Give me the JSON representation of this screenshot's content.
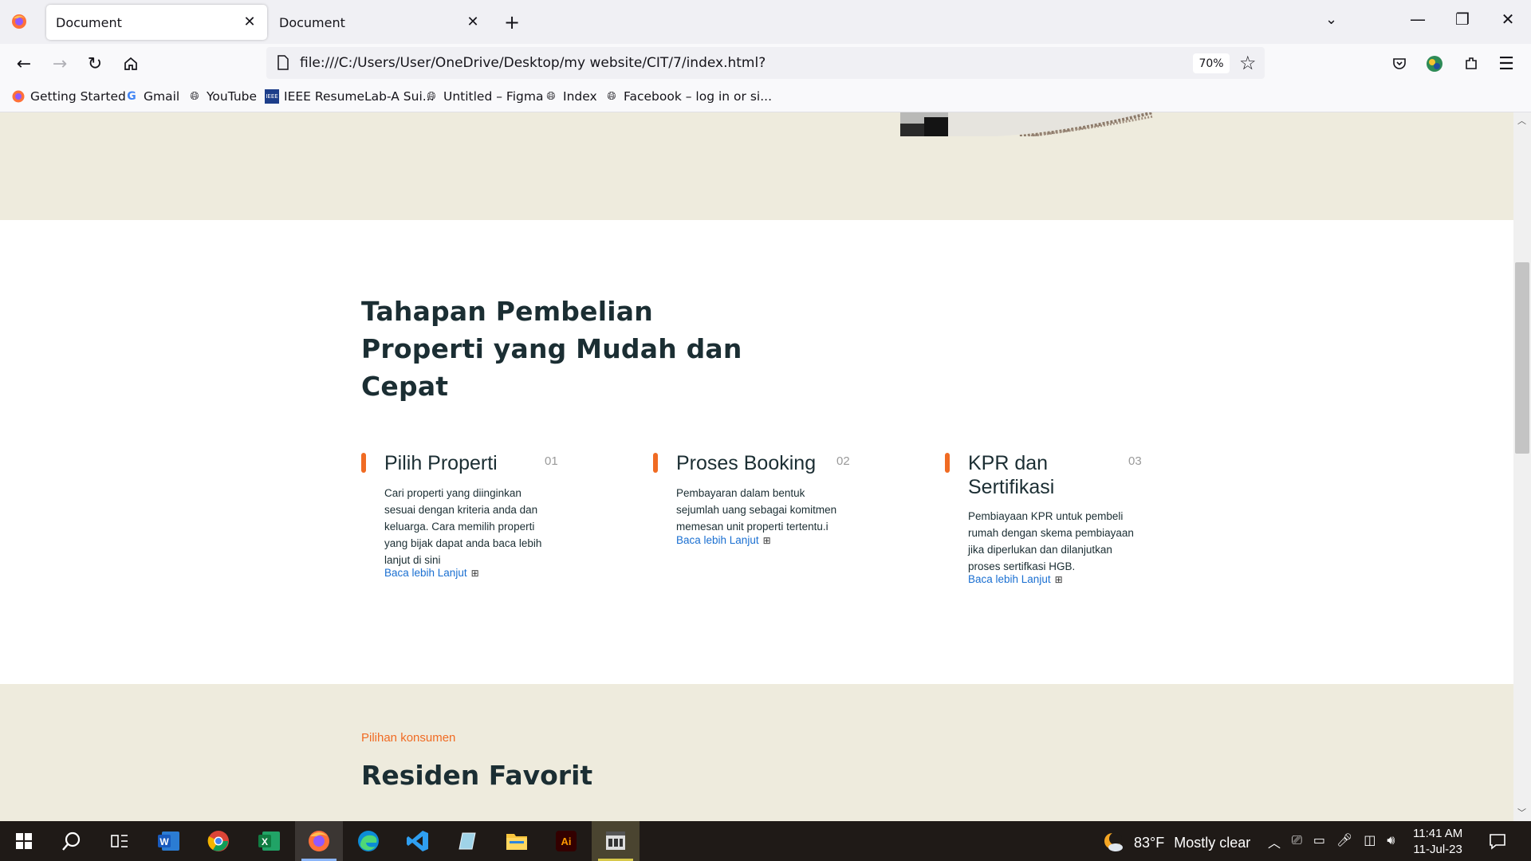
{
  "browser": {
    "tabs": [
      {
        "label": "Document",
        "active": true
      },
      {
        "label": "Document",
        "active": false
      }
    ],
    "url": "file:///C:/Users/User/OneDrive/Desktop/my website/CIT/7/index.html?",
    "zoom": "70%",
    "bookmarks": [
      {
        "label": "Getting Started",
        "icon": "firefox-icon"
      },
      {
        "label": "Gmail",
        "icon": "google-icon"
      },
      {
        "label": "YouTube",
        "icon": "globe-icon"
      },
      {
        "label": "IEEE ResumeLab-A Sui...",
        "icon": "ieee-icon"
      },
      {
        "label": "Untitled – Figma",
        "icon": "globe-icon"
      },
      {
        "label": "Index",
        "icon": "globe-icon"
      },
      {
        "label": "Facebook – log in or si...",
        "icon": "globe-icon"
      }
    ]
  },
  "page": {
    "steps_title": "Tahapan Pembelian Properti yang Mudah dan Cepat",
    "steps": [
      {
        "title": "Pilih Properti",
        "number": "01",
        "description": "Cari properti yang diinginkan sesuai dengan kriteria anda dan keluarga. Cara memilih properti yang bijak dapat anda baca lebih lanjut di sini",
        "link": "Baca lebih Lanjut"
      },
      {
        "title": "Proses Booking",
        "number": "02",
        "description": "Pembayaran dalam bentuk sejumlah uang sebagai komitmen memesan unit properti tertentu.i",
        "link": "Baca lebih Lanjut"
      },
      {
        "title": "KPR dan Sertifikasi",
        "number": "03",
        "description": "Pembiayaan KPR untuk pembeli rumah dengan skema pembiayaan jika diperlukan dan dilanjutkan proses sertifkasi HGB.",
        "link": "Baca lebih Lanjut"
      }
    ],
    "favorites_eyebrow": "Pilihan konsumen",
    "favorites_title": "Residen Favorit"
  },
  "taskbar": {
    "apps": [
      "windows-start",
      "search",
      "task-view",
      "word",
      "chrome",
      "excel",
      "firefox",
      "edge",
      "vscode",
      "notes",
      "file-explorer",
      "illustrator",
      "media-app"
    ],
    "active_app": "firefox",
    "weather": {
      "temp": "83°F",
      "condition": "Mostly clear"
    },
    "time": "11:41 AM",
    "date": "11-Jul-23"
  },
  "colors": {
    "accent": "#f06b23",
    "heading": "#1b2e33",
    "link": "#1a6fd1",
    "beige": "#eeebdd"
  }
}
